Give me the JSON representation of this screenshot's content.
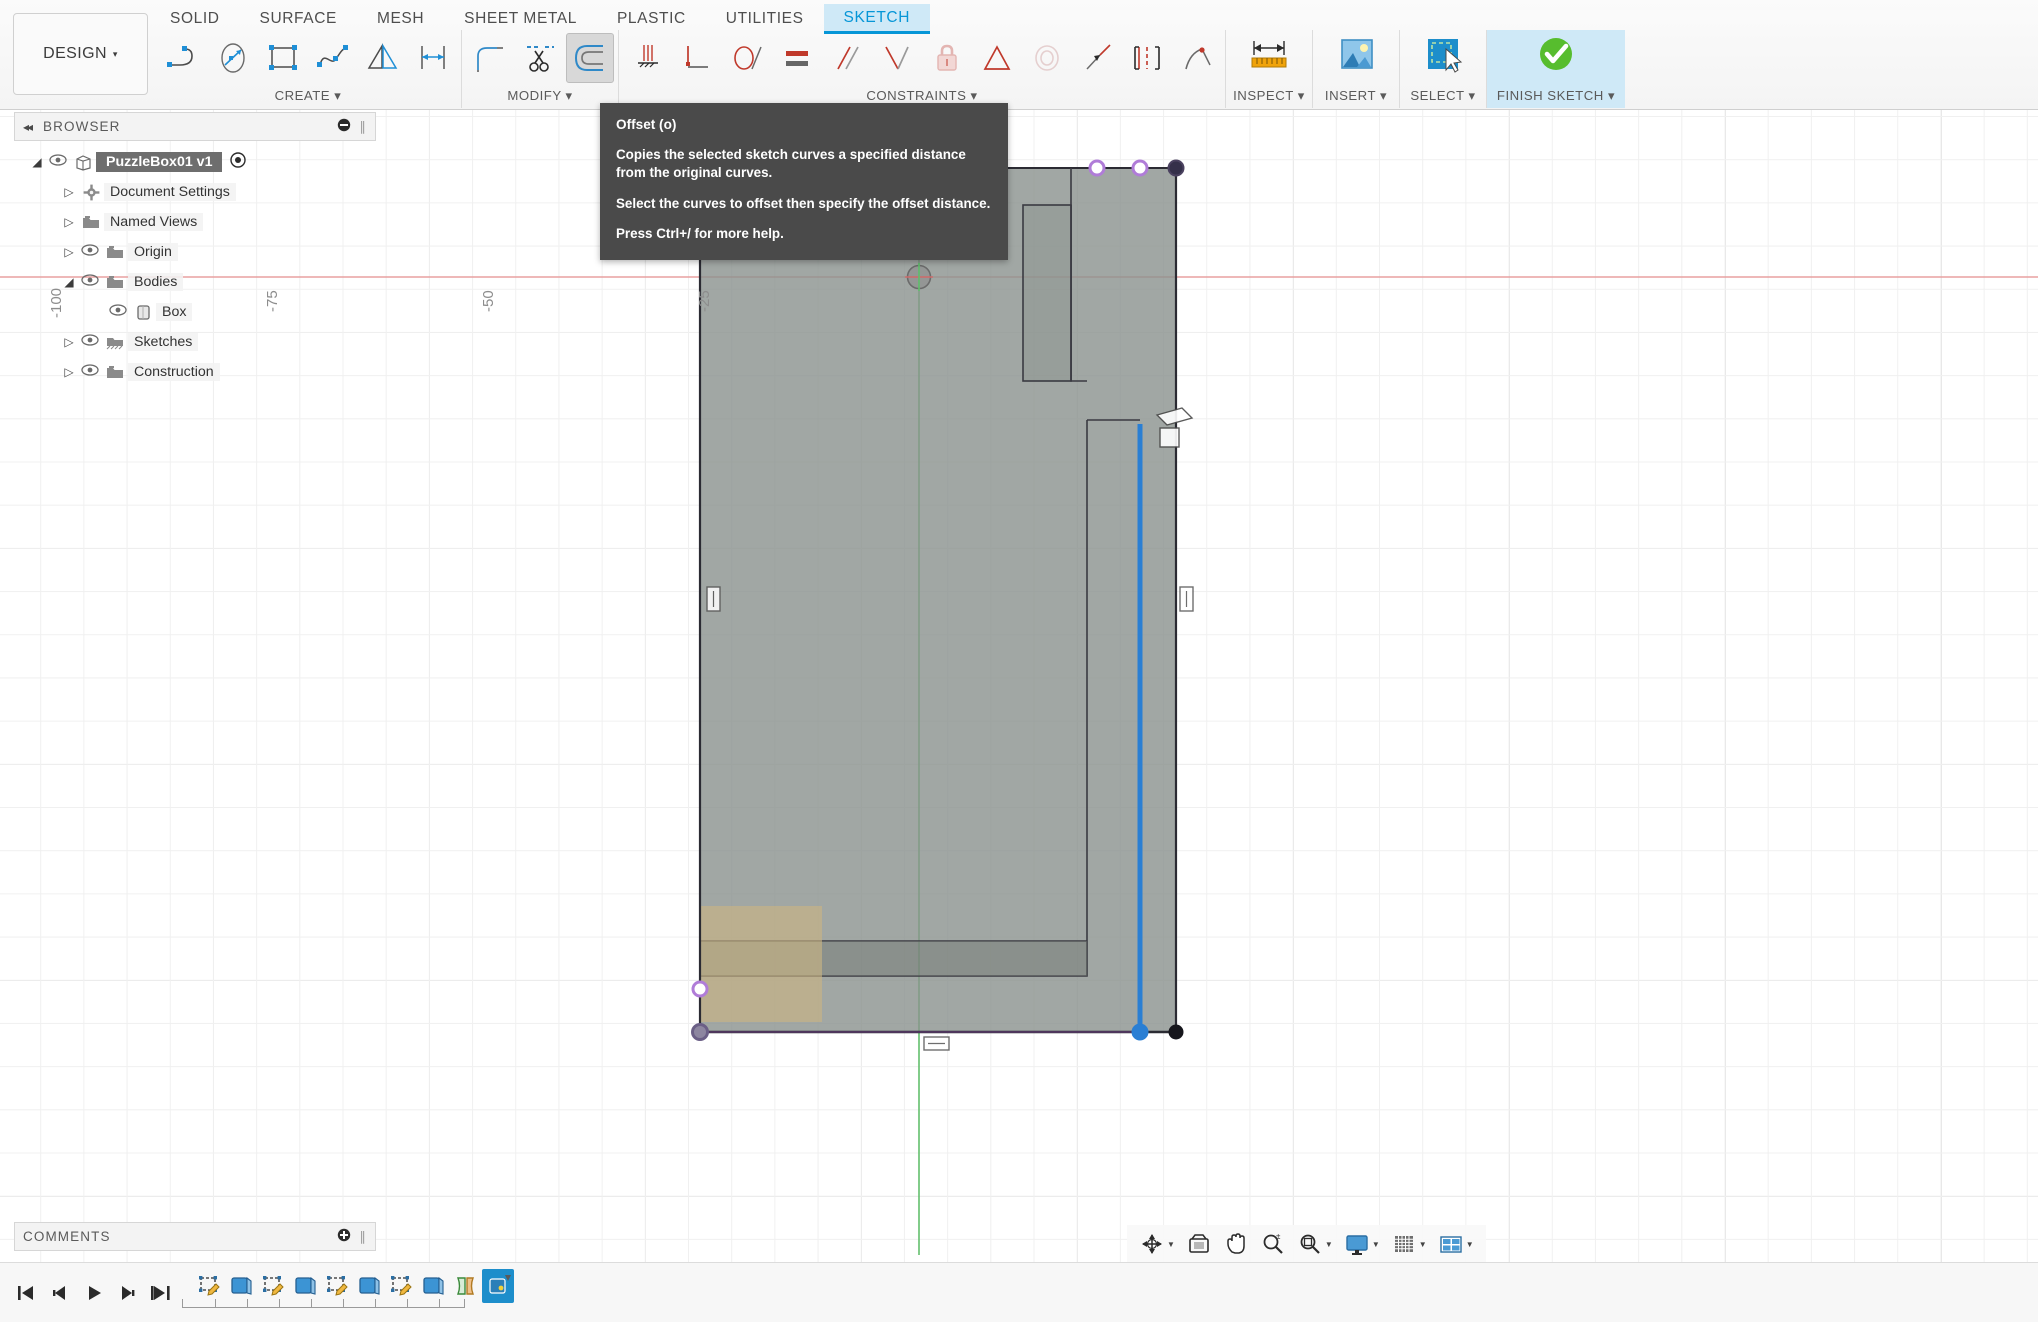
{
  "app": {
    "workspace_label": "DESIGN",
    "caret": "▾"
  },
  "tabs": [
    {
      "label": "SOLID",
      "active": false
    },
    {
      "label": "SURFACE",
      "active": false
    },
    {
      "label": "MESH",
      "active": false
    },
    {
      "label": "SHEET METAL",
      "active": false
    },
    {
      "label": "PLASTIC",
      "active": false
    },
    {
      "label": "UTILITIES",
      "active": false
    },
    {
      "label": "SKETCH",
      "active": true
    }
  ],
  "panels": {
    "create": {
      "label": "CREATE ▾",
      "tools": [
        "line-icon",
        "ellipse-icon",
        "rectangle-icon",
        "spline-icon",
        "mirror-icon",
        "sketch-dimension-icon"
      ]
    },
    "modify": {
      "label": "MODIFY ▾",
      "tools": [
        "fillet-icon",
        "trim-icon",
        "offset-icon"
      ],
      "selected_tool": "offset-icon"
    },
    "constraints": {
      "label": "CONSTRAINTS ▾",
      "tools": [
        "coincident-icon",
        "collinear-icon",
        "tangent-icon",
        "equal-icon",
        "parallel-icon",
        "perpendicular-icon",
        "fix-unfix-lock-icon",
        "midpoint-icon",
        "concentric-icon",
        "symmetry-icon",
        "curvature-icon",
        "horizontal-vertical-icon"
      ]
    },
    "inspect": {
      "label": "INSPECT ▾",
      "icon": "measure-ruler-icon"
    },
    "insert": {
      "label": "INSERT ▾",
      "icon": "insert-image-icon"
    },
    "select": {
      "label": "SELECT ▾",
      "icon": "select-window-cursor-icon"
    },
    "finish": {
      "label": "FINISH SKETCH ▾",
      "icon": "green-check-icon"
    }
  },
  "browser": {
    "title": "BROWSER",
    "collapse_icon": "collapse-left-icon",
    "options_icon": "panel-options-icon",
    "grip_icon": "panel-grip-icon",
    "tree": [
      {
        "label": "PuzzleBox01 v1",
        "indent": 0,
        "arrow": "open",
        "eye": true,
        "icon": "document-cube-icon",
        "root": true,
        "trailing": "target-icon"
      },
      {
        "label": "Document Settings",
        "indent": 1,
        "arrow": "closed",
        "eye": false,
        "icon": "gear-icon"
      },
      {
        "label": "Named Views",
        "indent": 1,
        "arrow": "closed",
        "eye": false,
        "icon": "folder-icon"
      },
      {
        "label": "Origin",
        "indent": 1,
        "arrow": "closed",
        "eye": true,
        "icon": "folder-icon"
      },
      {
        "label": "Bodies",
        "indent": 1,
        "arrow": "open",
        "eye": true,
        "icon": "folder-icon"
      },
      {
        "label": "Box",
        "indent": 2,
        "arrow": "none",
        "eye": true,
        "icon": "body-icon"
      },
      {
        "label": "Sketches",
        "indent": 1,
        "arrow": "closed",
        "eye": true,
        "icon": "sketches-folder-icon"
      },
      {
        "label": "Construction",
        "indent": 1,
        "arrow": "closed",
        "eye": true,
        "icon": "folder-icon"
      }
    ]
  },
  "comments": {
    "title": "COMMENTS",
    "add_icon": "add-comment-icon",
    "grip_icon": "panel-grip-icon"
  },
  "tooltip": {
    "title": "Offset (o)",
    "body1": "Copies the selected sketch curves a specified distance from the original curves.",
    "body2": "Select the curves to offset then specify the offset distance.",
    "body3": "Press Ctrl+/ for more help."
  },
  "navbar": {
    "items": [
      {
        "name": "orbit-icon",
        "caret": true
      },
      {
        "name": "look-at-icon",
        "caret": false
      },
      {
        "name": "pan-hand-icon",
        "caret": false
      },
      {
        "name": "zoom-icon",
        "caret": false
      },
      {
        "name": "zoom-window-icon",
        "caret": true
      },
      {
        "name": "display-settings-icon",
        "caret": true
      },
      {
        "name": "grid-snaps-icon",
        "caret": true
      },
      {
        "name": "viewports-icon",
        "caret": true
      }
    ]
  },
  "timeline": {
    "playback": [
      "skip-to-start-icon",
      "step-back-icon",
      "play-icon",
      "step-forward-icon",
      "skip-to-end-icon"
    ],
    "features": [
      "sketch-feature-icon",
      "extrude-feature-icon",
      "sketch-feature-icon",
      "extrude-feature-icon",
      "sketch-feature-icon",
      "extrude-feature-icon",
      "sketch-feature-icon",
      "extrude-feature-icon",
      "shell-feature-icon",
      "active-sketch-feature-icon"
    ],
    "active_index": 9
  },
  "canvas": {
    "ruler_labels": [
      "-100",
      "-75",
      "-50",
      "-25"
    ],
    "origin_icon": "sketch-origin-icon",
    "axis_colors": {
      "x_axis": "#e8a0a0",
      "y_axis": "#5fbf6a"
    },
    "selected_edge_color": "#2a7fd4",
    "constraint_markers": [
      "vertical-constraint-icon",
      "vertical-constraint-icon",
      "horizontal-constraint-icon",
      "offset-constraint-icon",
      "coincident-point-icon"
    ],
    "face_fill": "#8a918d",
    "highlight_fill": "#cbb583"
  }
}
